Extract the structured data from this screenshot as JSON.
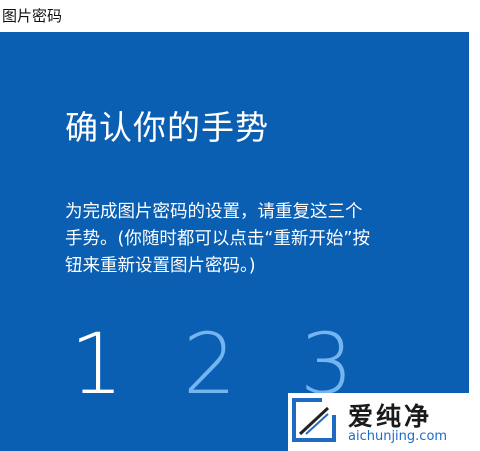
{
  "window": {
    "title": "图片密码"
  },
  "main": {
    "heading": "确认你的手势",
    "description_lines": [
      "为完成图片密码的设置，请重复这三个",
      "手势。(你随时都可以点击“重新开始”按",
      "钮来重新设置图片密码。)"
    ],
    "gesture_numbers": [
      "1",
      "2",
      "3"
    ],
    "active_gesture": 1
  },
  "watermark": {
    "brand": "爱纯净",
    "url": "aichunjing.com",
    "logo_icon": "aichunjing-logo-icon"
  },
  "colors": {
    "panel_bg": "#0b5fb3",
    "active_number": "#ffffff",
    "inactive_number": "#74b4ef",
    "url_color": "#1f6bc4"
  }
}
